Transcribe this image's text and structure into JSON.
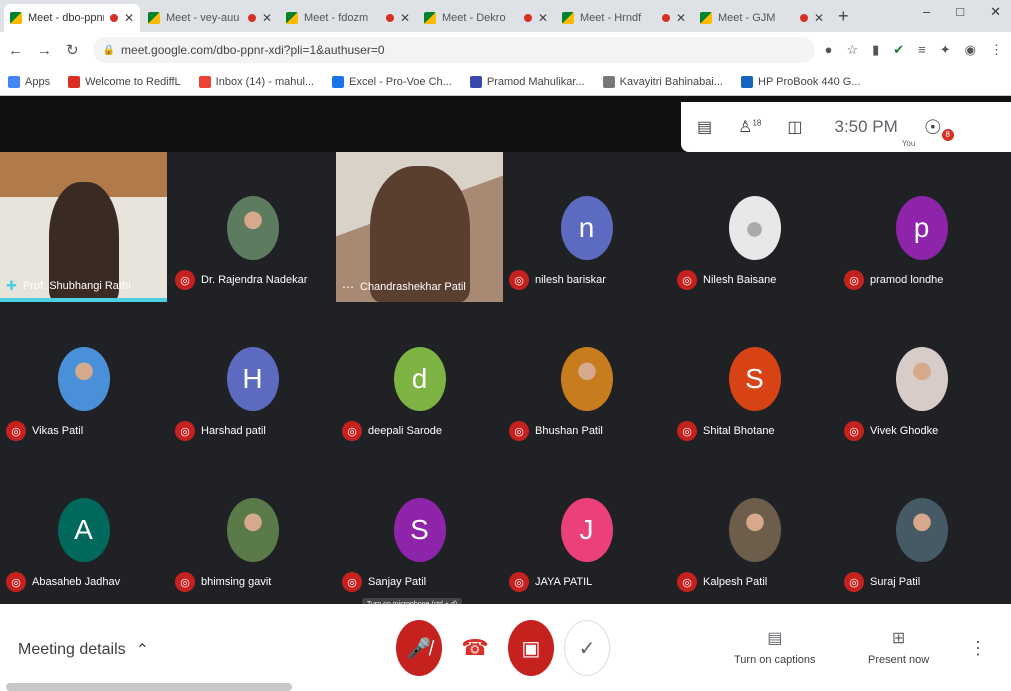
{
  "browser": {
    "tabs": [
      {
        "title": "Meet - dbo-ppnr",
        "active": true
      },
      {
        "title": "Meet - vey-auu",
        "active": false
      },
      {
        "title": "Meet - fdozm",
        "active": false
      },
      {
        "title": "Meet - Dekro",
        "active": false
      },
      {
        "title": "Meet - Hrndf",
        "active": false
      },
      {
        "title": "Meet - GJM",
        "active": false
      }
    ],
    "url": "meet.google.com/dbo-ppnr-xdi?pli=1&authuser=0",
    "bookmarks": [
      {
        "label": "Apps",
        "color": "#4285f4"
      },
      {
        "label": "Welcome to RediffL",
        "color": "#d93025"
      },
      {
        "label": "Inbox (14) - mahul...",
        "color": "#ea4335"
      },
      {
        "label": "Excel - Pro-Voe Ch...",
        "color": "#1a73e8"
      },
      {
        "label": "Pramod Mahulikar...",
        "color": "#3949ab"
      },
      {
        "label": "Kavayitri Bahinabai...",
        "color": "#777777"
      },
      {
        "label": "HP ProBook 440 G...",
        "color": "#1565c0"
      }
    ]
  },
  "meet_header": {
    "clock": "3:50 PM",
    "you_label": "You",
    "participant_badge": "18",
    "notification_badge": "8"
  },
  "participants": [
    {
      "name": "Prof. Shubhangi Rathi",
      "type": "video",
      "mic": "active"
    },
    {
      "name": "Dr. Rajendra Nadekar",
      "type": "photo",
      "color": "#5d7c5f"
    },
    {
      "name": "Chandrashekhar Patil",
      "type": "video",
      "mic": "more"
    },
    {
      "name": "nilesh bariskar",
      "type": "letter",
      "letter": "n",
      "color": "#5c6bc0"
    },
    {
      "name": "Nilesh Baisane",
      "type": "default",
      "color": "#e8e8e8"
    },
    {
      "name": "pramod londhe",
      "type": "letter",
      "letter": "p",
      "color": "#8e24aa"
    },
    {
      "name": "Vikas Patil",
      "type": "photo",
      "color": "#4a90d9"
    },
    {
      "name": "Harshad patil",
      "type": "letter",
      "letter": "H",
      "color": "#5c6bc0"
    },
    {
      "name": "deepali Sarode",
      "type": "letter",
      "letter": "d",
      "color": "#7cb342"
    },
    {
      "name": "Bhushan Patil",
      "type": "photo",
      "color": "#c77c1e"
    },
    {
      "name": "Shital Bhotane",
      "type": "letter",
      "letter": "S",
      "color": "#d84315"
    },
    {
      "name": "Vivek Ghodke",
      "type": "photo",
      "color": "#d7ccc8"
    },
    {
      "name": "Abasaheb Jadhav",
      "type": "letter",
      "letter": "A",
      "color": "#00695c"
    },
    {
      "name": "bhimsing gavit",
      "type": "photo",
      "color": "#5a7a4a"
    },
    {
      "name": "Sanjay Patil",
      "type": "letter",
      "letter": "S",
      "color": "#8e24aa"
    },
    {
      "name": "JAYA PATIL",
      "type": "letter",
      "letter": "J",
      "color": "#ec407a"
    },
    {
      "name": "Kalpesh Patil",
      "type": "photo",
      "color": "#6d5d4b"
    },
    {
      "name": "Suraj Patil",
      "type": "photo",
      "color": "#455a64"
    }
  ],
  "tooltip": "Turn on microphone (ctrl + d)",
  "bottom": {
    "meeting_details": "Meeting details",
    "captions_label": "Turn on captions",
    "present_label": "Present now"
  }
}
